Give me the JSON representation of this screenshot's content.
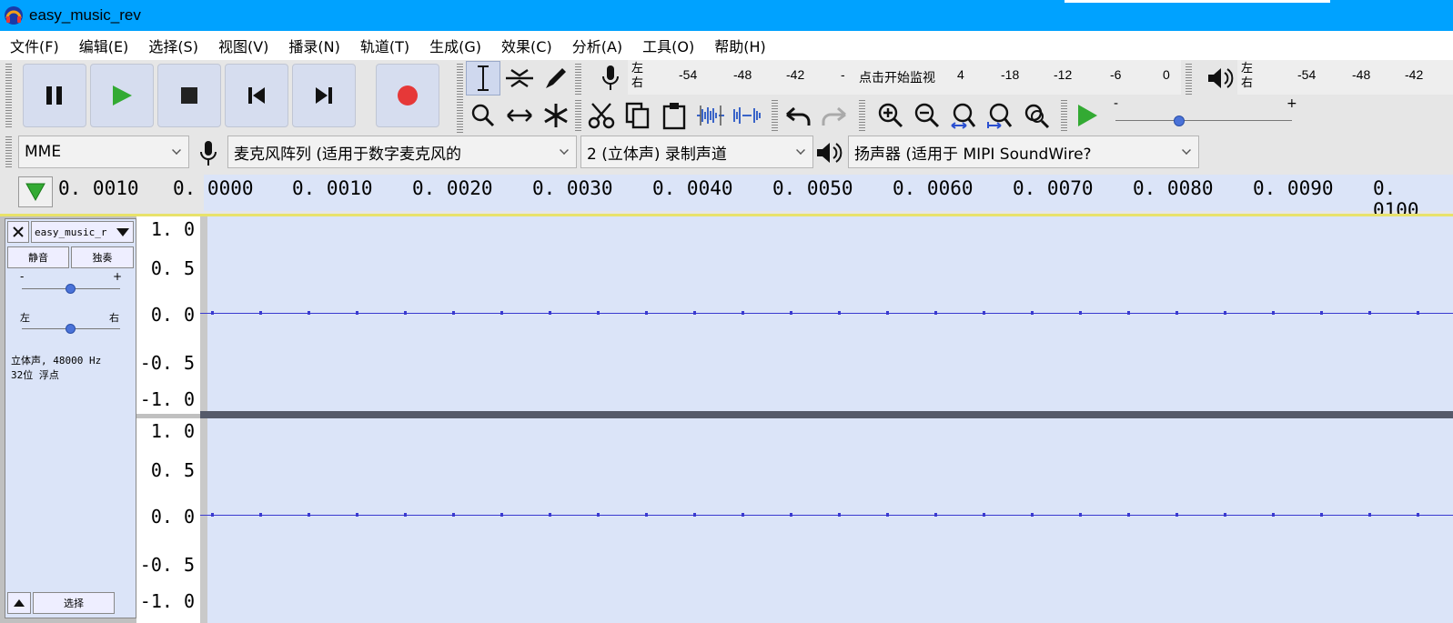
{
  "window": {
    "title": "easy_music_rev"
  },
  "menu": [
    "文件(F)",
    "编辑(E)",
    "选择(S)",
    "视图(V)",
    "播录(N)",
    "轨道(T)",
    "生成(G)",
    "效果(C)",
    "分析(A)",
    "工具(O)",
    "帮助(H)"
  ],
  "meter_rec": {
    "left": "左",
    "right": "右",
    "scale": [
      "-54",
      "-48",
      "-42",
      "-",
      "点击开始监视",
      "4",
      "-18",
      "-12",
      "-6",
      "0"
    ]
  },
  "meter_play": {
    "left": "左",
    "right": "右",
    "scale": [
      "-54",
      "-48",
      "-42"
    ]
  },
  "play_slider": {
    "minus": "-",
    "plus": "+",
    "value": 0.36
  },
  "device": {
    "host": "MME",
    "input": "麦克风阵列 (适用于数字麦克风的",
    "channels": "2 (立体声) 录制声道",
    "output": "扬声器 (适用于 MIPI SoundWire?"
  },
  "ruler": {
    "position": "0. 0010",
    "labels": [
      "0. 0000",
      "0. 0010",
      "0. 0020",
      "0. 0030",
      "0. 0040",
      "0. 0050",
      "0. 0060",
      "0. 0070",
      "0. 0080",
      "0. 0090",
      "0. 0100"
    ]
  },
  "track": {
    "name": "easy_music_r",
    "mute": "静音",
    "solo": "独奏",
    "gain_minus": "-",
    "gain_plus": "+",
    "gain": 0.5,
    "pan_left": "左",
    "pan_right": "右",
    "pan": 0.5,
    "info1": "立体声, 48000 Hz",
    "info2": "32位 浮点",
    "select": "选择"
  },
  "yaxis": [
    "1. 0",
    "0. 5",
    "0. 0",
    "-0. 5",
    "-1. 0"
  ],
  "colors": {
    "titlebar": "#00a2ff",
    "waveform": "#3a3ad0",
    "track_bg": "#dbe4f8",
    "record": "#e63838",
    "play": "#33aa33"
  }
}
